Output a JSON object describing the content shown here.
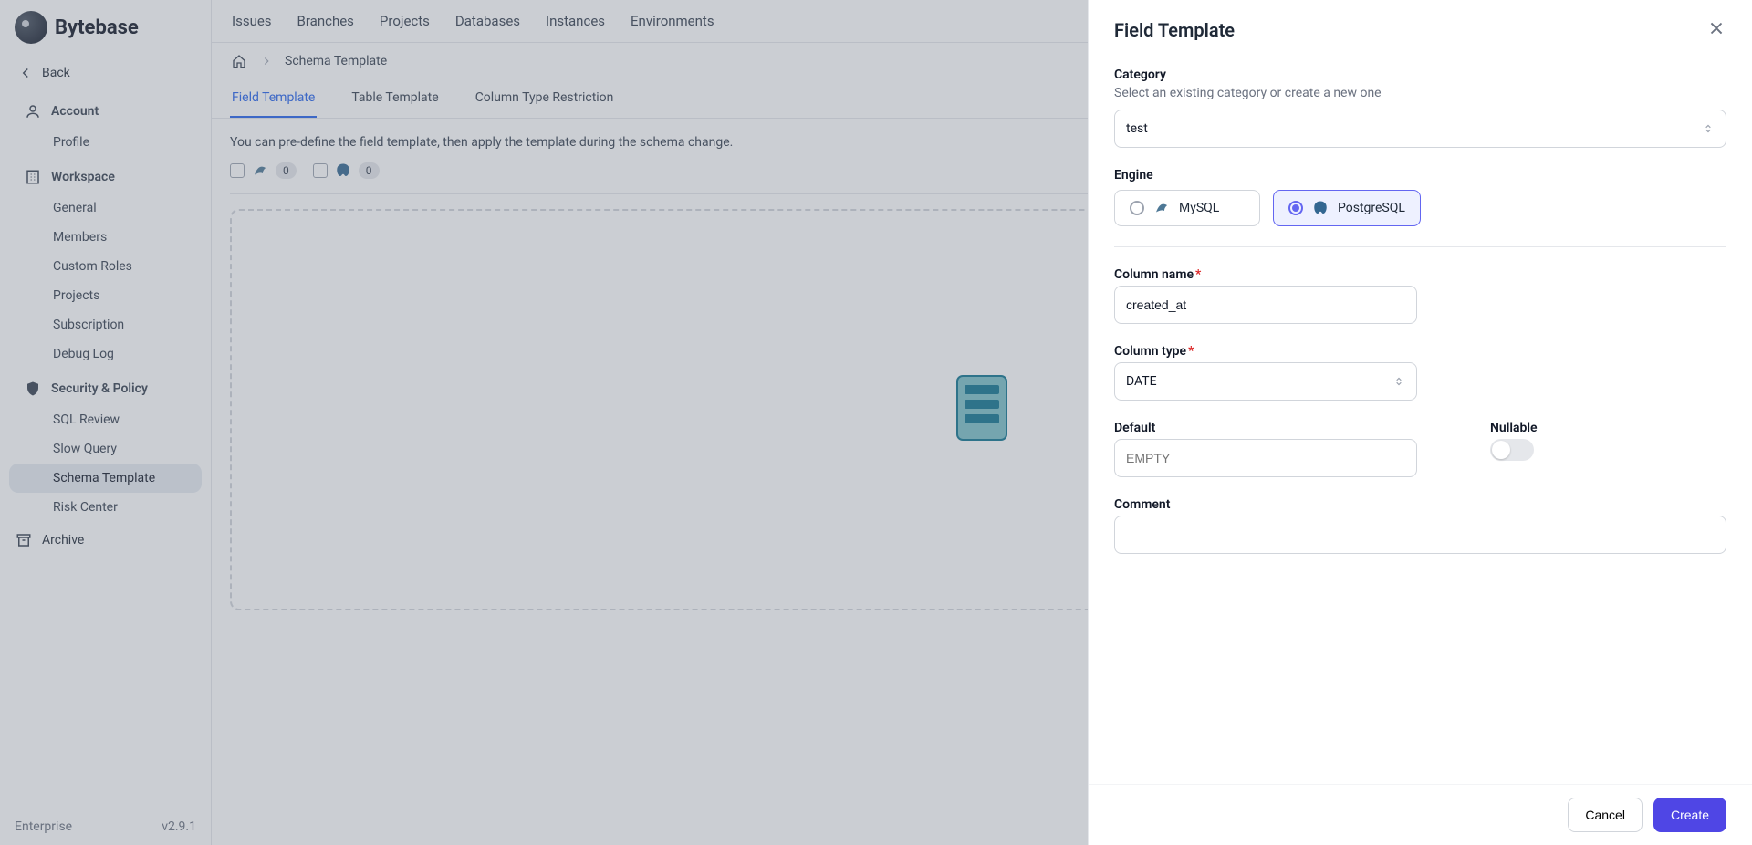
{
  "logo_text": "Bytebase",
  "back_label": "Back",
  "sidebar": {
    "sections": {
      "account": {
        "title": "Account",
        "profile": "Profile"
      },
      "workspace": {
        "title": "Workspace",
        "general": "General",
        "members": "Members",
        "custom_roles": "Custom Roles",
        "projects": "Projects",
        "subscription": "Subscription",
        "debug_log": "Debug Log"
      },
      "security": {
        "title": "Security & Policy",
        "sql_review": "SQL Review",
        "slow_query": "Slow Query",
        "schema_template": "Schema Template",
        "risk_center": "Risk Center"
      }
    },
    "archive": "Archive",
    "enterprise": "Enterprise",
    "version": "v2.9.1"
  },
  "topnav": {
    "issues": "Issues",
    "branches": "Branches",
    "projects": "Projects",
    "databases": "Databases",
    "instances": "Instances",
    "environments": "Environments"
  },
  "breadcrumb": {
    "current": "Schema Template"
  },
  "tabs": {
    "field_template": "Field Template",
    "table_template": "Table Template",
    "column_type_restriction": "Column Type Restriction"
  },
  "description": "You can pre-define the field template, then apply the template during the schema change.",
  "counts": {
    "mysql": "0",
    "postgres": "0"
  },
  "drawer": {
    "title": "Field Template",
    "category_label": "Category",
    "category_sub": "Select an existing category or create a new one",
    "category_value": "test",
    "engine_label": "Engine",
    "engine_mysql": "MySQL",
    "engine_postgres": "PostgreSQL",
    "column_name_label": "Column name",
    "column_name_value": "created_at",
    "column_type_label": "Column type",
    "column_type_value": "DATE",
    "default_label": "Default",
    "default_placeholder": "EMPTY",
    "nullable_label": "Nullable",
    "comment_label": "Comment",
    "cancel": "Cancel",
    "create": "Create"
  },
  "icons": {
    "mysql": "mysql-icon",
    "postgres": "postgres-icon"
  }
}
